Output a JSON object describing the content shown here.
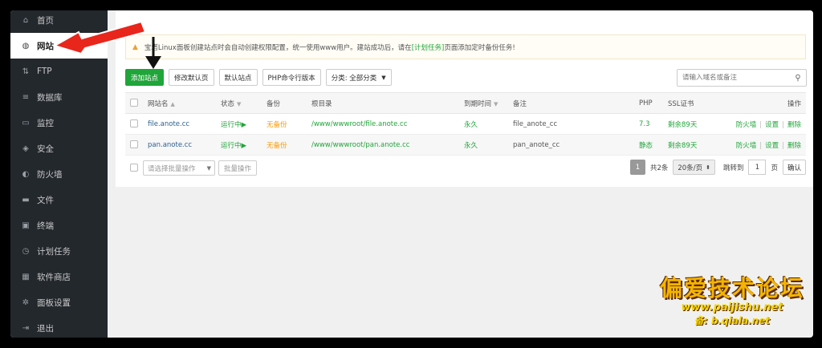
{
  "sidebar": {
    "items": [
      {
        "label": "首页",
        "icon": "home-icon",
        "glyph": "⌂"
      },
      {
        "label": "网站",
        "icon": "globe-icon",
        "glyph": "◍"
      },
      {
        "label": "FTP",
        "icon": "ftp-icon",
        "glyph": "⇅"
      },
      {
        "label": "数据库",
        "icon": "database-icon",
        "glyph": "≡"
      },
      {
        "label": "监控",
        "icon": "monitor-icon",
        "glyph": "▭"
      },
      {
        "label": "安全",
        "icon": "shield-icon",
        "glyph": "◈"
      },
      {
        "label": "防火墙",
        "icon": "firewall-icon",
        "glyph": "◐"
      },
      {
        "label": "文件",
        "icon": "folder-icon",
        "glyph": "▬"
      },
      {
        "label": "终端",
        "icon": "terminal-icon",
        "glyph": "▣"
      },
      {
        "label": "计划任务",
        "icon": "clock-icon",
        "glyph": "◷"
      },
      {
        "label": "软件商店",
        "icon": "apps-icon",
        "glyph": "▦"
      },
      {
        "label": "面板设置",
        "icon": "gear-icon",
        "glyph": "✲"
      },
      {
        "label": "退出",
        "icon": "logout-icon",
        "glyph": "⇥"
      }
    ]
  },
  "notice": {
    "text_before": "宝塔Linux面板创建站点时会自动创建权限配置，统一使用www用户。建站成功后，请在",
    "link": "[计划任务]",
    "text_after": "页面添加定时备份任务!"
  },
  "toolbar": {
    "add_site": "添加站点",
    "edit_default_page": "修改默认页",
    "default_site": "默认站点",
    "php_cli_version": "PHP命令行版本",
    "category": "分类: 全部分类"
  },
  "search": {
    "placeholder": "请输入域名或备注"
  },
  "table": {
    "headers": {
      "name": "网站名",
      "status": "状态",
      "backup": "备份",
      "root": "根目录",
      "expire": "到期时间",
      "note": "备注",
      "php": "PHP",
      "ssl": "SSL证书",
      "ops": "操作"
    },
    "rows": [
      {
        "name": "file.anote.cc",
        "status": "运行中▶",
        "backup": "无备份",
        "root": "/www/wwwroot/file.anote.cc",
        "expire": "永久",
        "note": "file_anote_cc",
        "php": "7.3",
        "ssl": "剩余89天",
        "op1": "防火墙",
        "op2": "设置",
        "op3": "删除"
      },
      {
        "name": "pan.anote.cc",
        "status": "运行中▶",
        "backup": "无备份",
        "root": "/www/wwwroot/pan.anote.cc",
        "expire": "永久",
        "note": "pan_anote_cc",
        "php": "静态",
        "ssl": "剩余89天",
        "op1": "防火墙",
        "op2": "设置",
        "op3": "删除"
      }
    ]
  },
  "footer": {
    "batch_placeholder": "请选择批量操作",
    "batch_button": "批量操作",
    "current_page": "1",
    "total": "共2条",
    "page_size": "20条/页",
    "goto_label": "跳转到",
    "goto_value": "1",
    "page_unit": "页",
    "confirm": "确认"
  },
  "watermark": {
    "line1": "偏爱技术论坛",
    "line2": "www.paijishu.net",
    "line3": "备: b.qiala.net"
  },
  "colors": {
    "accent": "#20a53a",
    "sidebar_bg": "#23282d",
    "warning": "#ff9900",
    "arrow": "#e8261c"
  }
}
